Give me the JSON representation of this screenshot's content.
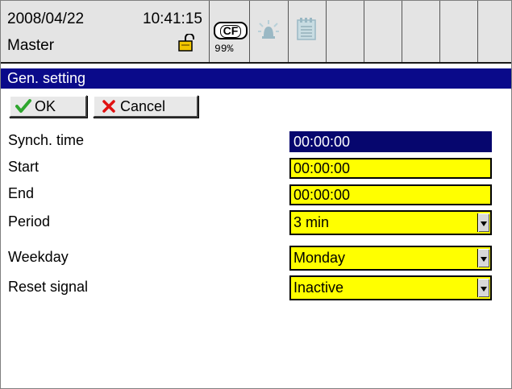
{
  "status": {
    "date": "2008/04/22",
    "time": "10:41:15",
    "user": "Master",
    "cf_label": "CF",
    "cf_percent": "99%",
    "icons": [
      "lock-open-icon",
      "alarm-icon",
      "memo-icon"
    ]
  },
  "window": {
    "title": "Gen. setting"
  },
  "buttons": {
    "ok_label": "OK",
    "cancel_label": "Cancel"
  },
  "form": {
    "synch_time": {
      "label": "Synch. time",
      "value": "00:00:00",
      "selected": true
    },
    "start": {
      "label": "Start",
      "value": "00:00:00"
    },
    "end": {
      "label": "End",
      "value": "00:00:00"
    },
    "period": {
      "label": "Period",
      "value": "3 min"
    },
    "weekday": {
      "label": "Weekday",
      "value": "Monday"
    },
    "reset_signal": {
      "label": "Reset signal",
      "value": "Inactive"
    }
  },
  "colors": {
    "title_bar": "#0a0a8a",
    "field_bg": "#ffff00",
    "selected_field_bg": "#06066e",
    "ok_check": "#2ea62e",
    "cancel_x": "#e01010"
  }
}
